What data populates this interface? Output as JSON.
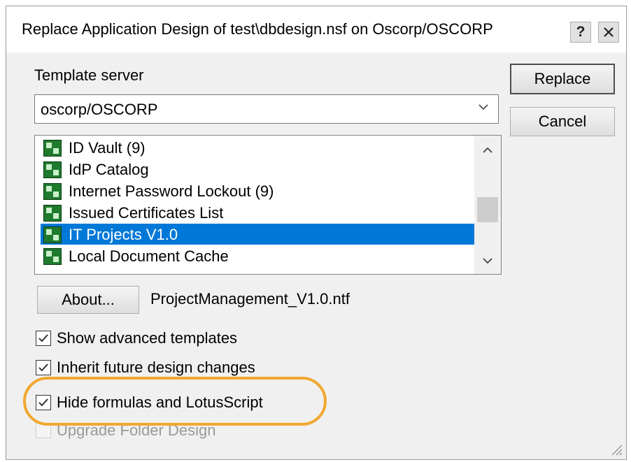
{
  "dialog": {
    "title": "Replace Application Design of test\\dbdesign.nsf on Oscorp/OSCORP",
    "help_label": "?",
    "close_label": "✕"
  },
  "form": {
    "template_server_label": "Template server",
    "template_server_value": "oscorp/OSCORP",
    "templates": [
      {
        "name": "ID Vault (9)",
        "selected": false
      },
      {
        "name": "IdP Catalog",
        "selected": false
      },
      {
        "name": "Internet Password Lockout (9)",
        "selected": false
      },
      {
        "name": "Issued Certificates List",
        "selected": false
      },
      {
        "name": "IT Projects V1.0",
        "selected": true
      },
      {
        "name": "Local Document Cache",
        "selected": false
      }
    ],
    "about_label": "About...",
    "template_filename": "ProjectManagement_V1.0.ntf"
  },
  "buttons": {
    "replace_label": "Replace",
    "cancel_label": "Cancel"
  },
  "options": [
    {
      "label": "Show advanced templates",
      "checked": true,
      "disabled": false
    },
    {
      "label": "Inherit future design changes",
      "checked": true,
      "disabled": false
    },
    {
      "label": "Hide formulas and LotusScript",
      "checked": true,
      "disabled": false
    },
    {
      "label": "Upgrade Folder Design",
      "checked": false,
      "disabled": true
    }
  ],
  "colors": {
    "selection": "#0078d7",
    "highlight_ring": "#f0a830"
  }
}
